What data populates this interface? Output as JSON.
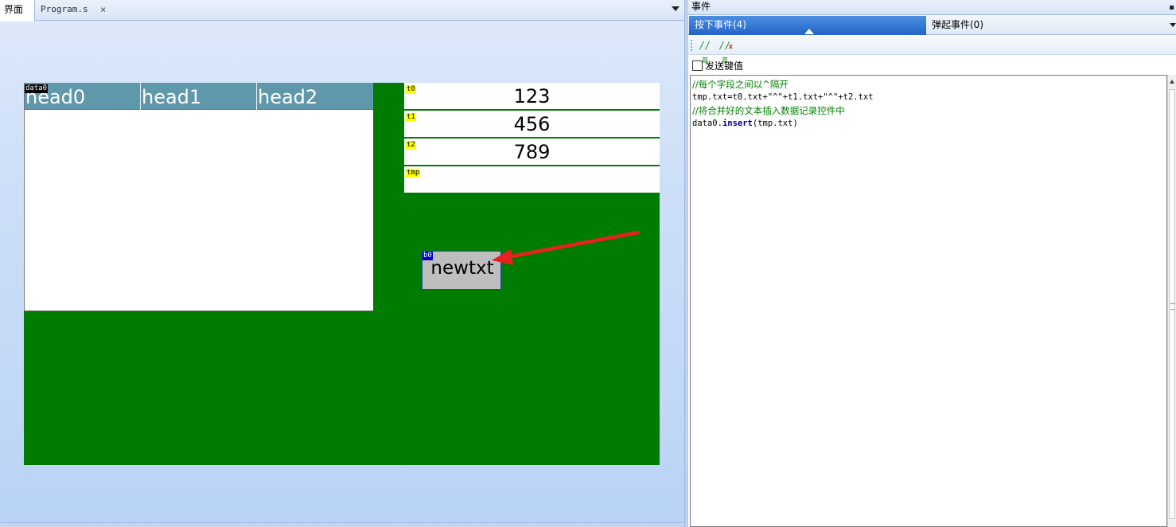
{
  "tabs": {
    "ui": "界面",
    "program": "Program.s",
    "close": "×"
  },
  "canvas": {
    "background": "#007c00",
    "grid": {
      "tag": "data0",
      "headers": [
        "head0",
        "head1",
        "head2"
      ]
    },
    "fields": [
      {
        "tag": "t0",
        "value": "123"
      },
      {
        "tag": "t1",
        "value": "456"
      },
      {
        "tag": "t2",
        "value": "789"
      },
      {
        "tag": "tmp",
        "value": ""
      }
    ],
    "button": {
      "tag": "b0",
      "label": "newtxt"
    }
  },
  "events_panel": {
    "title": "事件",
    "pin_icon": "pin-icon",
    "tabs": {
      "press": "按下事件(4)",
      "release": "弹起事件(0)"
    },
    "toolbar": {
      "comment_icon": "comment-icon",
      "uncomment_icon": "uncomment-icon",
      "comment_glyph": "//≡",
      "uncomment_glyph": "//≡",
      "uncomment_x": "x"
    },
    "send_key_label": "发送键值",
    "code": {
      "line1": "//每个字段之间以^隔开",
      "line2": "tmp.txt=t0.txt+\"^\"+t1.txt+\"^\"+t2.txt",
      "line3": "//将合并好的文本插入数据记录控件中",
      "line4_obj": "data0.",
      "line4_kw": "insert",
      "line4_rest": "(tmp.txt)"
    }
  },
  "colors": {
    "accent": "#2364c8",
    "annotation_arrow": "#e82020"
  }
}
